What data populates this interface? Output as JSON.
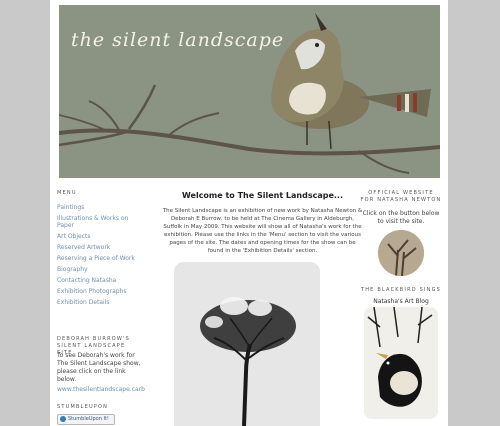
{
  "header": {
    "site_title": "the silent landscape"
  },
  "nav": {
    "heading": "MENU",
    "items": [
      "Paintings",
      "Illustrations & Works on Paper",
      "Art Objects",
      "Reserved Artwork",
      "Reserving a Piece of Work",
      "Biography",
      "Contacting Natasha",
      "Exhibition Photographs",
      "Exhibition Details"
    ]
  },
  "burrow": {
    "heading": "DEBORAH BURROW'S SILENT LANDSCAPE SITE",
    "text": "To see Deborah's work for The Silent Landscape show, please click on the link below.",
    "link": "www.thesilentlandscape.carb"
  },
  "stumble": {
    "heading": "STUMBLEUPON",
    "badge": "StumbleUpon It!"
  },
  "main": {
    "welcome": "Welcome to The Silent Landscape...",
    "intro": "The Silent Landscape is an exhibition of new work by Natasha Newton & Deborah E Burrow, to be held at The Cinema Gallery in Aldeburgh, Suffolk in May 2009. This website will show all of Natasha's work for the exhibition. Please use the links in the 'Menu' section to visit the various pages of the site. The dates and opening times for the show can be found in the 'Exhibition Details' section."
  },
  "right": {
    "heading": "OFFICIAL WEBSITE FOR NATASHA NEWTON",
    "text": "Click on the button below to visit the site.",
    "blackbird_heading": "THE BLACKBIRD SINGS",
    "blog_title": "Natasha's Art Blog"
  }
}
